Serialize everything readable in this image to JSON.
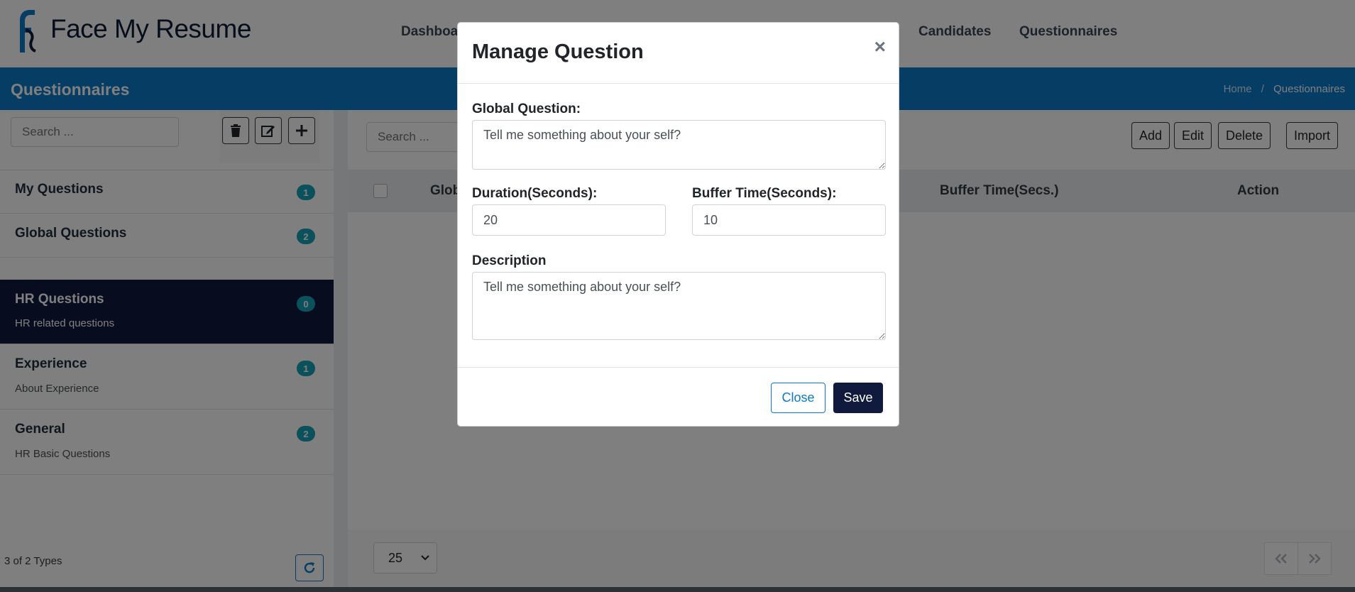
{
  "app": {
    "name": "Face My Resume"
  },
  "nav": {
    "items": [
      {
        "label": "Dashboard"
      },
      {
        "label": "Candidates"
      },
      {
        "label": "Questionnaires"
      }
    ]
  },
  "titlebar": {
    "title": "Questionnaires",
    "breadcrumb": [
      "Home",
      "/",
      "Questionnaires"
    ]
  },
  "left_panel": {
    "search_placeholder": "Search ...",
    "items": [
      {
        "name": "My Questions",
        "subtitle": "",
        "count": "1",
        "active": false
      },
      {
        "name": "Global Questions",
        "subtitle": "",
        "count": "2",
        "active": false
      },
      {
        "name": "HR Questions",
        "subtitle": "HR related questions",
        "count": "0",
        "active": true
      },
      {
        "name": "Experience",
        "subtitle": "About Experience",
        "count": "1",
        "active": false
      },
      {
        "name": "General",
        "subtitle": "HR Basic Questions",
        "count": "2",
        "active": false
      }
    ],
    "footer_count": "3 of 2 Types"
  },
  "right_panel": {
    "search_placeholder": "Search ...",
    "buttons": {
      "add": "Add",
      "edit": "Edit",
      "delete": "Delete",
      "import": "Import"
    },
    "columns": [
      "Glob",
      "Buffer Time(Secs.)",
      "Action"
    ],
    "page_size": "25"
  },
  "modal": {
    "title": "Manage Question",
    "close_x": "×",
    "global_question_label": "Global Question:",
    "global_question_value": "Tell me something about your self?",
    "duration_label": "Duration(Seconds):",
    "duration_value": "20",
    "buffer_label": "Buffer Time(Seconds):",
    "buffer_value": "10",
    "description_label": "Description",
    "description_value": "Tell me something about your self?",
    "close_button": "Close",
    "save_button": "Save"
  },
  "colors": {
    "primary": "#0a7bc9",
    "navy": "#0f1a3c",
    "badge": "#17a2b8"
  }
}
